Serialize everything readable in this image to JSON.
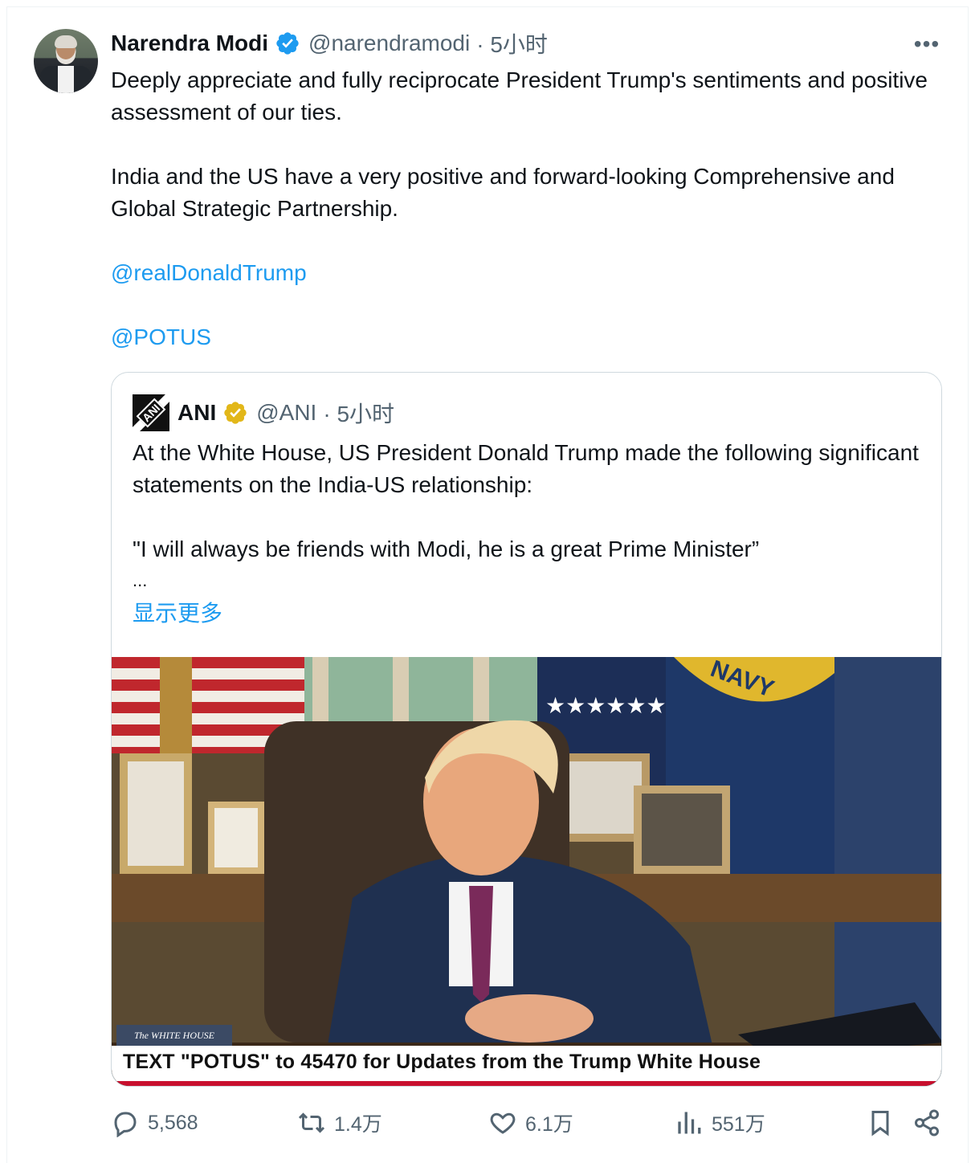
{
  "tweet": {
    "author_name": "Narendra Modi",
    "author_handle": "@narendramodi",
    "time": "· 5小时",
    "more_label": "•••",
    "paragraphs": [
      "Deeply appreciate and fully reciprocate President Trump's sentiments and positive assessment of our ties.",
      "India and the US have a very positive and forward-looking Comprehensive and Global Strategic Partnership."
    ],
    "mentions": [
      "@realDonaldTrump",
      "@POTUS"
    ]
  },
  "quoted": {
    "author_name": "ANI",
    "author_handle": "@ANI",
    "time": "· 5小时",
    "logo_text": "ANI",
    "paragraphs": [
      "At the White House, US President Donald Trump made the following significant statements on the India-US relationship:",
      "\"I will always be friends with Modi, he is a great Prime Minister”"
    ],
    "ellipsis": "...",
    "show_more": "显示更多",
    "media": {
      "caption": "TEXT \"POTUS\" to 45470 for Updates from the Trump White House",
      "source_tag": "The WHITE HOUSE",
      "navy_text": "NAVY"
    }
  },
  "actions": {
    "replies": "5,568",
    "reposts": "1.4万",
    "likes": "6.1万",
    "views": "551万"
  },
  "colors": {
    "link": "#1d9bf0",
    "secondary_text": "#536471",
    "verified_blue": "#1d9bf0",
    "verified_gold": "#e2b719",
    "border": "#cfd9de"
  }
}
